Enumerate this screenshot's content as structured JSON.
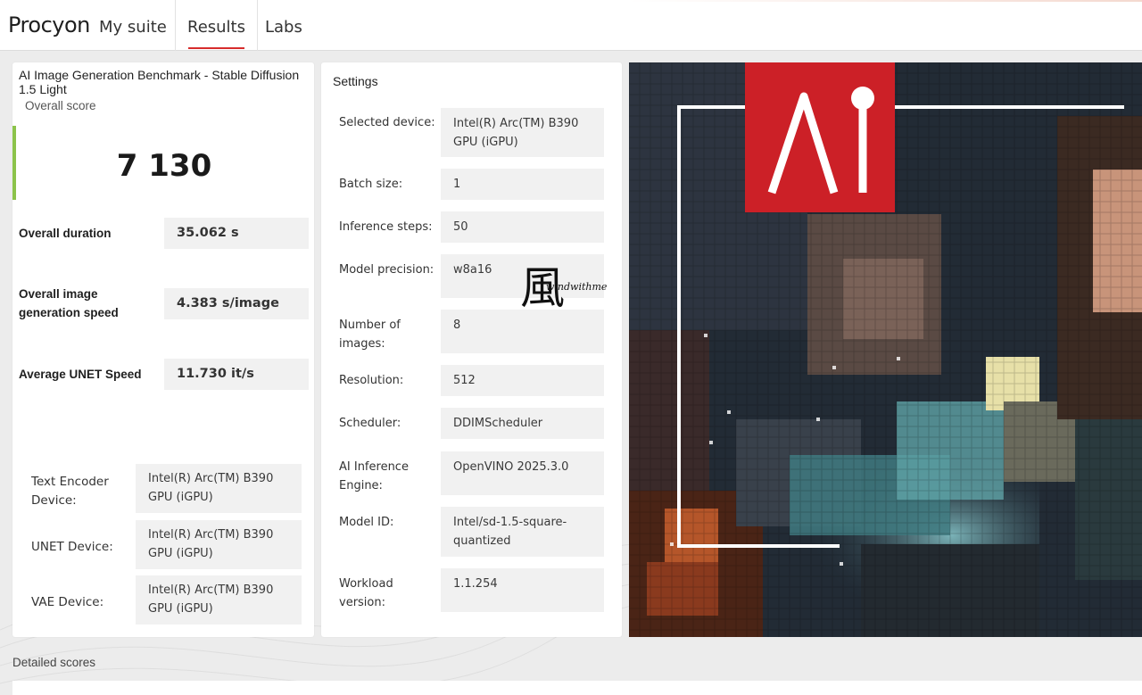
{
  "app": {
    "brand": "Procyon"
  },
  "nav": {
    "tabs": [
      {
        "label": "My suite",
        "active": false
      },
      {
        "label": "Results",
        "active": true
      },
      {
        "label": "Labs",
        "active": false
      }
    ],
    "accent_color": "#d72c2c"
  },
  "result": {
    "title": "AI Image Generation Benchmark - Stable Diffusion 1.5 Light",
    "overall_label": "Overall score",
    "overall_score": "7 130",
    "score_bar_color": "#8cc34a",
    "metrics": [
      {
        "label": "Overall duration",
        "value": "35.062 s"
      },
      {
        "label": "Overall image generation speed",
        "value": "4.383 s/image"
      },
      {
        "label": "Average UNET Speed",
        "value": "11.730 it/s"
      }
    ],
    "devices": [
      {
        "label": "Text Encoder Device:",
        "value": "Intel(R) Arc(TM) B390 GPU (iGPU)"
      },
      {
        "label": "UNET Device:",
        "value": "Intel(R) Arc(TM) B390 GPU (iGPU)"
      },
      {
        "label": "VAE Device:",
        "value": "Intel(R) Arc(TM) B390 GPU (iGPU)"
      }
    ]
  },
  "settings": {
    "title": "Settings",
    "rows": [
      {
        "label": "Selected device:",
        "value": "Intel(R) Arc(TM) B390 GPU (iGPU)"
      },
      {
        "label": "Batch size:",
        "value": "1"
      },
      {
        "label": "Inference steps:",
        "value": "50"
      },
      {
        "label": "Model precision:",
        "value": "w8a16"
      },
      {
        "label": "Number of images:",
        "value": "8"
      },
      {
        "label": "Resolution:",
        "value": "512"
      },
      {
        "label": "Scheduler:",
        "value": "DDIMScheduler"
      },
      {
        "label": "AI Inference Engine:",
        "value": "OpenVINO 2025.3.0"
      },
      {
        "label": "Model ID:",
        "value": "Intel/sd-1.5-square-quantized"
      },
      {
        "label": "Workload version:",
        "value": "1.1.254"
      }
    ]
  },
  "watermark": {
    "glyph": "風",
    "text": "windwithme"
  },
  "hero": {
    "logo_text": "AI",
    "logo_color": "#cc2027"
  },
  "detailed": {
    "label": "Detailed scores"
  }
}
